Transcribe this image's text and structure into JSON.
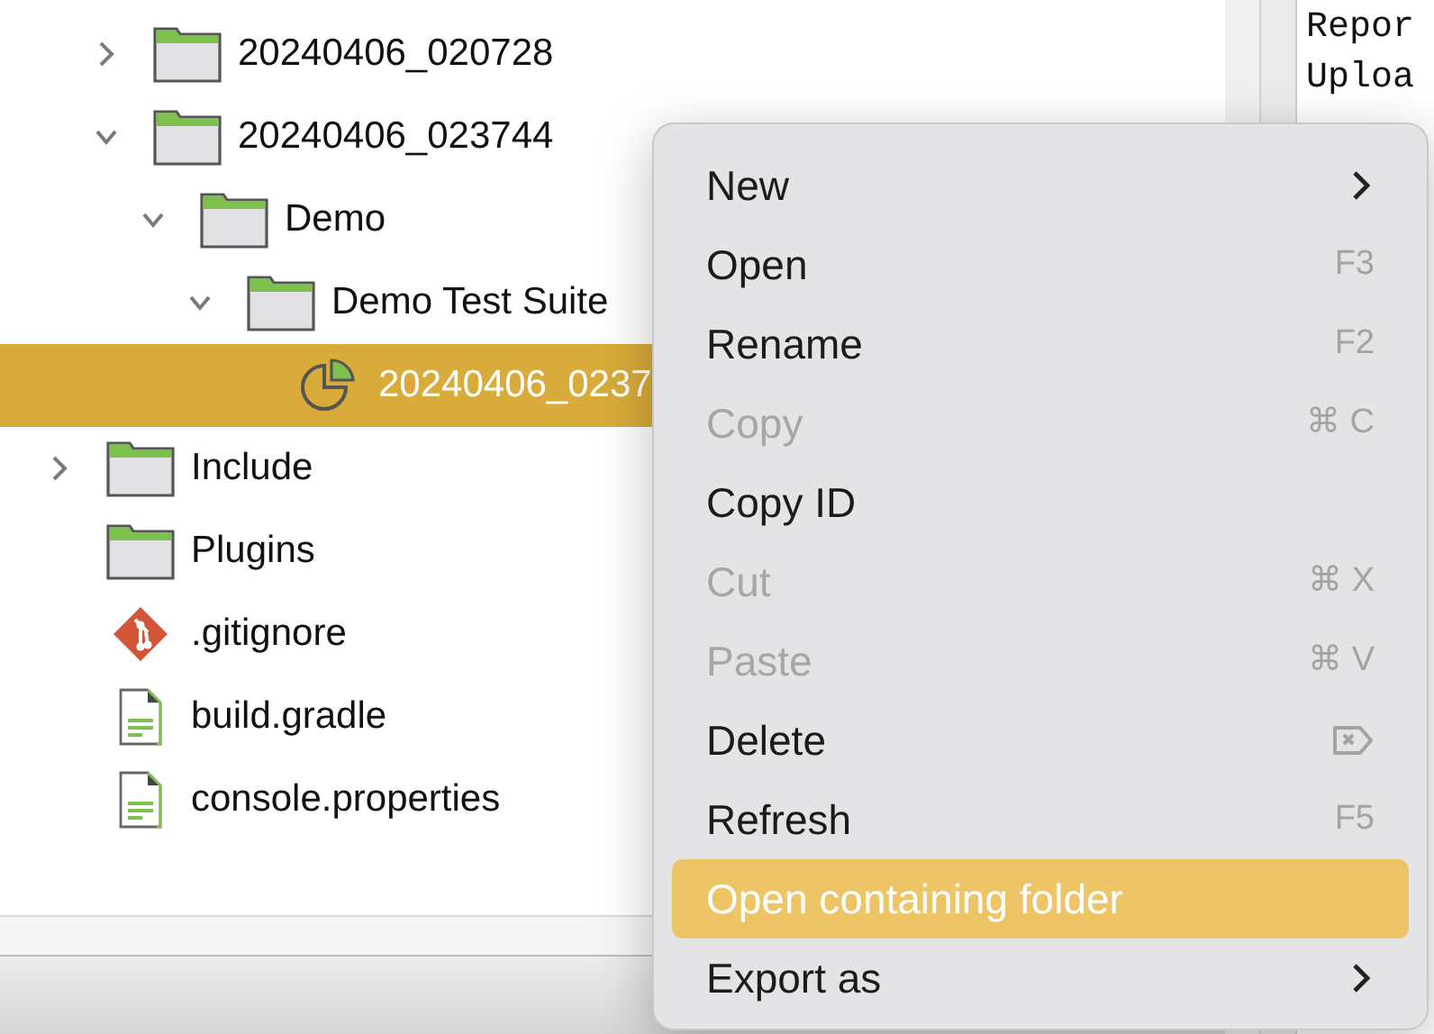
{
  "tree": [
    {
      "label": "20240406_020728",
      "kind": "folder",
      "expanded": false,
      "selected": false
    },
    {
      "label": "20240406_023744",
      "kind": "folder",
      "expanded": true,
      "selected": false,
      "children": [
        {
          "label": "Demo",
          "kind": "folder",
          "expanded": true,
          "selected": false,
          "children": [
            {
              "label": "Demo Test Suite",
              "kind": "folder",
              "expanded": true,
              "selected": false,
              "children": [
                {
                  "label": "20240406_0237",
                  "kind": "report",
                  "selected": true
                }
              ]
            }
          ]
        }
      ]
    }
  ],
  "tree_root": [
    {
      "label": "Include",
      "kind": "folder",
      "expanded": false,
      "selected": false
    },
    {
      "label": "Plugins",
      "kind": "folder",
      "selected": false
    },
    {
      "label": ".gitignore",
      "kind": "git",
      "selected": false
    },
    {
      "label": "build.gradle",
      "kind": "file",
      "selected": false
    },
    {
      "label": "console.properties",
      "kind": "file",
      "selected": false
    }
  ],
  "console": [
    "Repor",
    "Uploa"
  ],
  "context_menu": [
    {
      "label": "New",
      "kind": "submenu",
      "disabled": false,
      "selected": false
    },
    {
      "label": "Open",
      "kind": "shortcut",
      "shortcut": "F3",
      "disabled": false,
      "selected": false
    },
    {
      "label": "Rename",
      "kind": "shortcut",
      "shortcut": "F2",
      "disabled": false,
      "selected": false
    },
    {
      "label": "Copy",
      "kind": "shortcut",
      "shortcut": "⌘ C",
      "disabled": true,
      "selected": false
    },
    {
      "label": "Copy ID",
      "kind": "plain",
      "disabled": false,
      "selected": false
    },
    {
      "label": "Cut",
      "kind": "shortcut",
      "shortcut": "⌘ X",
      "disabled": true,
      "selected": false
    },
    {
      "label": "Paste",
      "kind": "shortcut",
      "shortcut": "⌘ V",
      "disabled": true,
      "selected": false
    },
    {
      "label": "Delete",
      "kind": "delete_key",
      "disabled": false,
      "selected": false
    },
    {
      "label": "Refresh",
      "kind": "shortcut",
      "shortcut": "F5",
      "disabled": false,
      "selected": false
    },
    {
      "label": "Open containing folder",
      "kind": "plain",
      "disabled": false,
      "selected": true
    },
    {
      "label": "Export as",
      "kind": "submenu",
      "disabled": false,
      "selected": false
    }
  ]
}
